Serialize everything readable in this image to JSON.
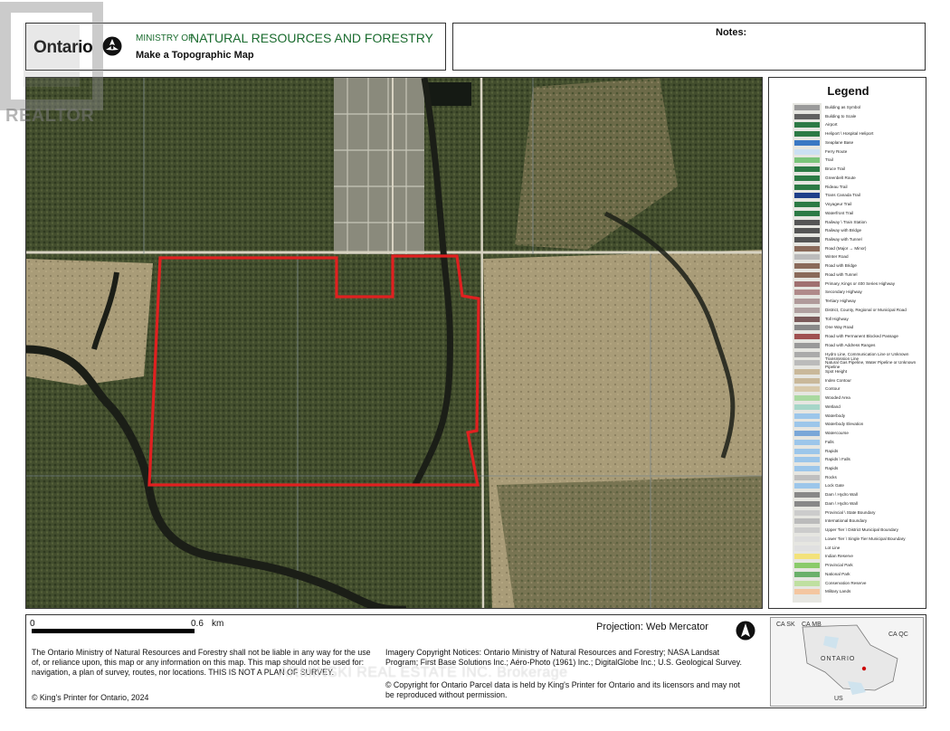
{
  "header": {
    "logo_text": "Ontario",
    "ministry_prefix": "MINISTRY OF",
    "ministry_name": "NATURAL RESOURCES AND FORESTRY",
    "title": "Make a Topographic Map"
  },
  "notes": {
    "label": "Notes:"
  },
  "legend": {
    "title": "Legend",
    "items": [
      "Building as Symbol",
      "Building to Scale",
      "Airport",
      "Heliport \\ Hospital Heliport",
      "Seaplane Base",
      "Ferry Route",
      "Trail",
      "Bruce Trail",
      "Greenbelt Route",
      "Rideau Trail",
      "Trans Canada Trail",
      "Voyageur Trail",
      "Waterfront Trail",
      "Railway \\ Train Station",
      "Railway with Bridge",
      "Railway with Tunnel",
      "Road (Major → Minor)",
      "Winter Road",
      "Road with Bridge",
      "Road with Tunnel",
      "Primary, Kings or 400 Series Highway",
      "Secondary Highway",
      "Tertiary Highway",
      "District, County, Regional or Municipal Road",
      "Toll Highway",
      "One Way Road",
      "Road with Permanent Blocked Passage",
      "Road with Address Ranges",
      "Hydro Line, Communication Line or Unknown Transmission Line",
      "Natural Gas Pipeline, Water Pipeline or Unknown Pipeline",
      "Spot Height",
      "Index Contour",
      "Contour",
      "Wooded Area",
      "Wetland",
      "Waterbody",
      "Waterbody Elevation",
      "Watercourse",
      "Falls",
      "Rapids",
      "Rapids \\ Falls",
      "Rapids",
      "Rocks",
      "Lock Gate",
      "Dam \\ Hydro Wall",
      "Dam \\ Hydro Wall",
      "Provincial \\ State Boundary",
      "International Boundary",
      "Upper Tier \\ District Municipal Boundary",
      "Lower Tier \\ Single Tier Municipal Boundary",
      "Lot Line",
      "Indian Reserve",
      "Provincial Park",
      "National Park",
      "Conservation Reserve",
      "Military Lands"
    ]
  },
  "scale": {
    "zero": "0",
    "distance": "0.6",
    "unit": "km"
  },
  "projection": "Projection: Web Mercator",
  "disclaimer": "The Ontario Ministry of Natural Resources and Forestry shall not be liable in any way for the use of, or reliance upon, this map or any information on this map.  This map should not be used for: navigation, a plan of survey, routes, nor locations. THIS IS NOT A PLAN OF SURVEY.",
  "kings_printer": "© King's Printer for Ontario,  2024",
  "imagery_notice": "Imagery Copyright Notices: Ontario Ministry of Natural Resources and Forestry; NASA Landsat Program; First Base Solutions Inc.; Aéro-Photo (1961) Inc.; DigitalGlobe Inc.; U.S. Geological Survey.",
  "copyright_notice": "© Copyright for Ontario Parcel data is held by King's Printer for Ontario and its licensors and may not be reproduced without permission.",
  "inset": {
    "labels": [
      "CA SK",
      "CA MB",
      "ONTARIO",
      "CA QC",
      "US"
    ]
  },
  "watermark": "ARMINSKI REAL ESTATE INC. Brokerage",
  "realtor_mark": "REALTOR",
  "colors": {
    "ministry_green": "#1a6b2e",
    "parcel_outline": "#e02020",
    "forest": "#3e4a2a",
    "field": "#a89a74",
    "river": "#1b1e17"
  }
}
